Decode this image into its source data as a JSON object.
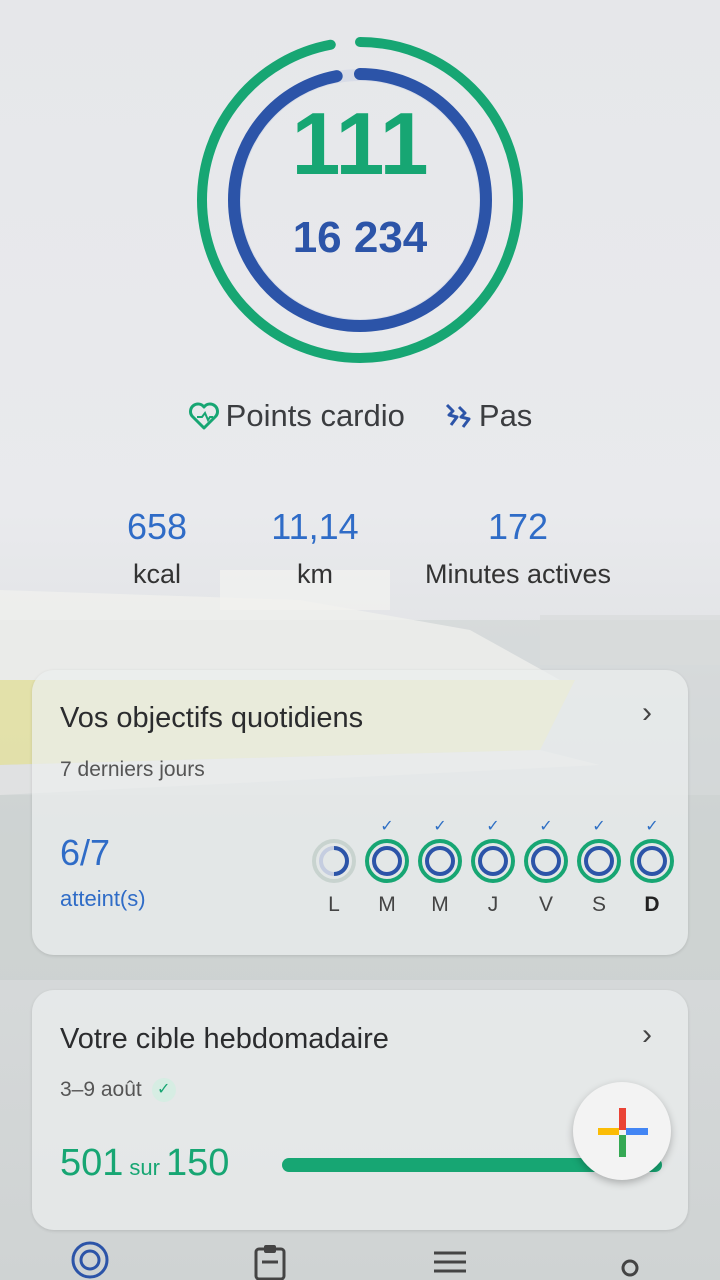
{
  "rings": {
    "heart_points": "111",
    "steps": "16 234",
    "outer_color": "#17a673",
    "inner_color": "#2c54a8",
    "outer_progress": 0.97,
    "inner_progress": 0.97
  },
  "legend": {
    "heart_label": "Points cardio",
    "heart_icon": "heart-points-icon",
    "steps_label": "Pas",
    "steps_icon": "steps-icon"
  },
  "stats": [
    {
      "value": "658",
      "label": "kcal"
    },
    {
      "value": "11,14",
      "label": "km"
    },
    {
      "value": "172",
      "label": "Minutes actives"
    }
  ],
  "daily_goals": {
    "title": "Vos objectifs quotidiens",
    "subtitle": "7 derniers jours",
    "achieved": "6/7",
    "achieved_label": "atteint(s)",
    "days": [
      {
        "label": "L",
        "done": false
      },
      {
        "label": "M",
        "done": true
      },
      {
        "label": "M",
        "done": true
      },
      {
        "label": "J",
        "done": true
      },
      {
        "label": "V",
        "done": true
      },
      {
        "label": "S",
        "done": true
      },
      {
        "label": "D",
        "done": true,
        "today": true
      }
    ]
  },
  "weekly_target": {
    "title": "Votre cible hebdomadaire",
    "date_range": "3–9 août",
    "value": "501",
    "sur": "sur",
    "target": "150",
    "progress": 1.0
  },
  "fab": {
    "icon": "add-icon"
  },
  "nav": [
    {
      "icon": "home-icon"
    },
    {
      "icon": "journal-icon"
    },
    {
      "icon": "browse-icon"
    },
    {
      "icon": "profile-icon"
    }
  ]
}
